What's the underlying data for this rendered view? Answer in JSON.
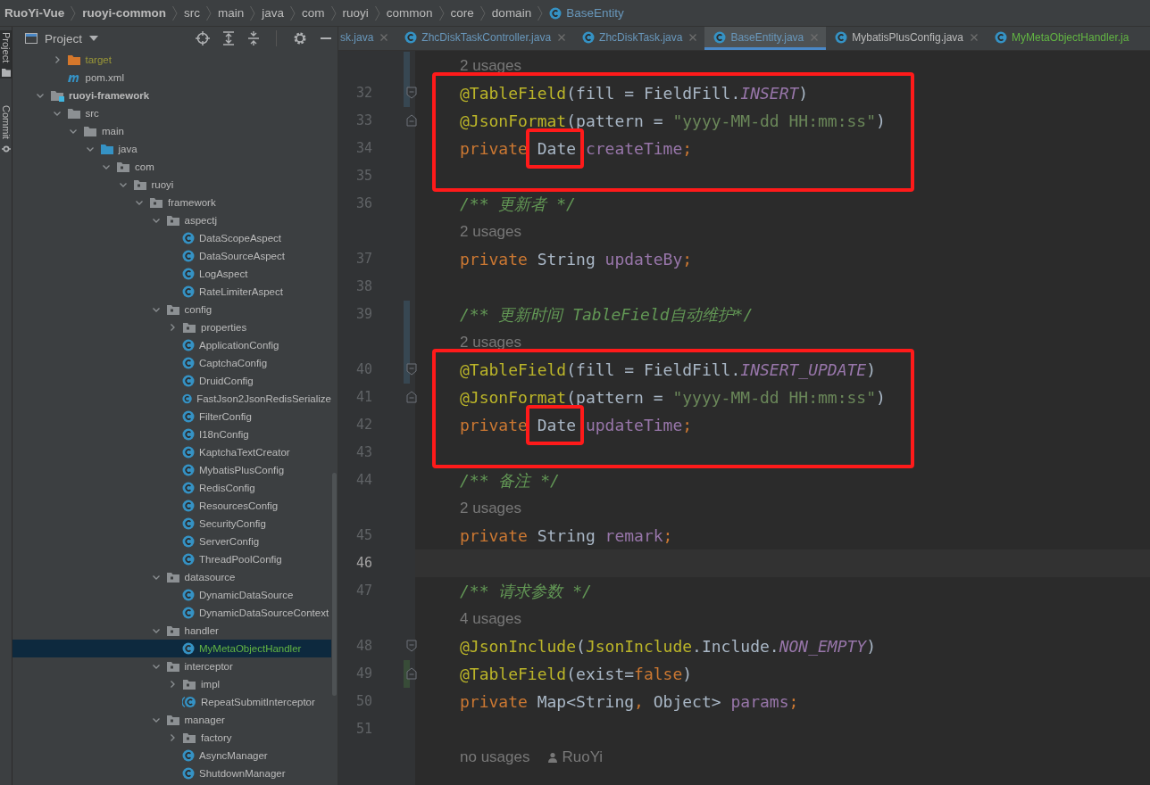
{
  "breadcrumbs": [
    {
      "label": "RuoYi-Vue",
      "kind": "module"
    },
    {
      "label": "ruoyi-common",
      "kind": "module"
    },
    {
      "label": "src",
      "kind": "folder"
    },
    {
      "label": "main",
      "kind": "folder"
    },
    {
      "label": "java",
      "kind": "folder"
    },
    {
      "label": "com",
      "kind": "folder"
    },
    {
      "label": "ruoyi",
      "kind": "folder"
    },
    {
      "label": "common",
      "kind": "folder"
    },
    {
      "label": "core",
      "kind": "folder"
    },
    {
      "label": "domain",
      "kind": "folder"
    },
    {
      "label": "BaseEntity",
      "kind": "class"
    }
  ],
  "side_strip": [
    {
      "label": "Project",
      "selected": true
    },
    {
      "label": "Commit",
      "selected": false
    }
  ],
  "panel": {
    "title": "Project"
  },
  "tree": [
    {
      "children": [
        {
          "label": "target",
          "kind": "excluded",
          "expanded": false,
          "selected": false,
          "color": "#9a9738"
        },
        {
          "label": "pom.xml",
          "kind": "maven",
          "selected": false,
          "color": "#bbbbbb"
        }
      ]
    },
    {
      "label": "ruoyi-framework",
      "kind": "module",
      "expanded": true,
      "selected": false,
      "color": "#bbbbbb",
      "children": [
        {
          "label": "src",
          "kind": "folder",
          "expanded": true,
          "selected": false,
          "color": "#bbbbbb",
          "children": [
            {
              "label": "main",
              "kind": "folder",
              "expanded": true,
              "selected": false,
              "color": "#bbbbbb",
              "children": [
                {
                  "label": "java",
                  "kind": "source",
                  "expanded": true,
                  "selected": false,
                  "color": "#bbbbbb",
                  "children": [
                    {
                      "label": "com",
                      "kind": "package",
                      "expanded": true,
                      "selected": false,
                      "color": "#bbbbbb",
                      "children": [
                        {
                          "label": "ruoyi",
                          "kind": "package",
                          "expanded": true,
                          "selected": false,
                          "color": "#bbbbbb",
                          "children": [
                            {
                              "label": "framework",
                              "kind": "package",
                              "expanded": true,
                              "selected": false,
                              "color": "#bbbbbb",
                              "children": [
                                {
                                  "label": "aspectj",
                                  "kind": "package",
                                  "expanded": true,
                                  "selected": false,
                                  "color": "#bbbbbb",
                                  "children": [
                                    {
                                      "label": "DataScopeAspect",
                                      "kind": "class",
                                      "selected": false,
                                      "color": "#bbbbbb"
                                    },
                                    {
                                      "label": "DataSourceAspect",
                                      "kind": "class",
                                      "selected": false,
                                      "color": "#bbbbbb"
                                    },
                                    {
                                      "label": "LogAspect",
                                      "kind": "class",
                                      "selected": false,
                                      "color": "#bbbbbb"
                                    },
                                    {
                                      "label": "RateLimiterAspect",
                                      "kind": "class",
                                      "selected": false,
                                      "color": "#bbbbbb"
                                    }
                                  ]
                                },
                                {
                                  "label": "config",
                                  "kind": "package",
                                  "expanded": true,
                                  "selected": false,
                                  "color": "#bbbbbb",
                                  "children": [
                                    {
                                      "label": "properties",
                                      "kind": "package",
                                      "expanded": false,
                                      "selected": false,
                                      "color": "#bbbbbb"
                                    },
                                    {
                                      "label": "ApplicationConfig",
                                      "kind": "class",
                                      "selected": false,
                                      "color": "#bbbbbb"
                                    },
                                    {
                                      "label": "CaptchaConfig",
                                      "kind": "class",
                                      "selected": false,
                                      "color": "#bbbbbb"
                                    },
                                    {
                                      "label": "DruidConfig",
                                      "kind": "class",
                                      "selected": false,
                                      "color": "#bbbbbb"
                                    },
                                    {
                                      "label": "FastJson2JsonRedisSerialize",
                                      "kind": "class",
                                      "selected": false,
                                      "color": "#bbbbbb"
                                    },
                                    {
                                      "label": "FilterConfig",
                                      "kind": "class",
                                      "selected": false,
                                      "color": "#bbbbbb"
                                    },
                                    {
                                      "label": "I18nConfig",
                                      "kind": "class",
                                      "selected": false,
                                      "color": "#bbbbbb"
                                    },
                                    {
                                      "label": "KaptchaTextCreator",
                                      "kind": "class",
                                      "selected": false,
                                      "color": "#bbbbbb"
                                    },
                                    {
                                      "label": "MybatisPlusConfig",
                                      "kind": "class",
                                      "selected": false,
                                      "color": "#bbbbbb"
                                    },
                                    {
                                      "label": "RedisConfig",
                                      "kind": "class",
                                      "selected": false,
                                      "color": "#bbbbbb"
                                    },
                                    {
                                      "label": "ResourcesConfig",
                                      "kind": "class",
                                      "selected": false,
                                      "color": "#bbbbbb"
                                    },
                                    {
                                      "label": "SecurityConfig",
                                      "kind": "class",
                                      "selected": false,
                                      "color": "#bbbbbb"
                                    },
                                    {
                                      "label": "ServerConfig",
                                      "kind": "class",
                                      "selected": false,
                                      "color": "#bbbbbb"
                                    },
                                    {
                                      "label": "ThreadPoolConfig",
                                      "kind": "class",
                                      "selected": false,
                                      "color": "#bbbbbb"
                                    }
                                  ]
                                },
                                {
                                  "label": "datasource",
                                  "kind": "package",
                                  "expanded": true,
                                  "selected": false,
                                  "color": "#bbbbbb",
                                  "children": [
                                    {
                                      "label": "DynamicDataSource",
                                      "kind": "class",
                                      "selected": false,
                                      "color": "#bbbbbb"
                                    },
                                    {
                                      "label": "DynamicDataSourceContext",
                                      "kind": "class",
                                      "selected": false,
                                      "color": "#bbbbbb"
                                    }
                                  ]
                                },
                                {
                                  "label": "handler",
                                  "kind": "package",
                                  "expanded": true,
                                  "selected": false,
                                  "color": "#bbbbbb",
                                  "children": [
                                    {
                                      "label": "MyMetaObjectHandler",
                                      "kind": "class",
                                      "selected": true,
                                      "color": "#62b543"
                                    }
                                  ]
                                },
                                {
                                  "label": "interceptor",
                                  "kind": "package",
                                  "expanded": true,
                                  "selected": false,
                                  "color": "#bbbbbb",
                                  "children": [
                                    {
                                      "label": "impl",
                                      "kind": "package",
                                      "expanded": false,
                                      "selected": false,
                                      "color": "#bbbbbb"
                                    },
                                    {
                                      "label": "RepeatSubmitInterceptor",
                                      "kind": "abstract",
                                      "selected": false,
                                      "color": "#bbbbbb"
                                    }
                                  ]
                                },
                                {
                                  "label": "manager",
                                  "kind": "package",
                                  "expanded": true,
                                  "selected": false,
                                  "color": "#bbbbbb",
                                  "children": [
                                    {
                                      "label": "factory",
                                      "kind": "package",
                                      "expanded": false,
                                      "selected": false,
                                      "color": "#bbbbbb"
                                    },
                                    {
                                      "label": "AsyncManager",
                                      "kind": "class",
                                      "selected": false,
                                      "color": "#bbbbbb"
                                    },
                                    {
                                      "label": "ShutdownManager",
                                      "kind": "class",
                                      "selected": false,
                                      "color": "#bbbbbb"
                                    }
                                  ]
                                }
                              ]
                            }
                          ]
                        }
                      ]
                    }
                  ]
                }
              ]
            }
          ]
        }
      ]
    }
  ],
  "tabs": [
    {
      "label": "sk.java",
      "kind": "partial",
      "selected": false,
      "color": "#6897bb"
    },
    {
      "label": "ZhcDiskTaskController.java",
      "kind": "class",
      "selected": false,
      "color": "#6897bb"
    },
    {
      "label": "ZhcDiskTask.java",
      "kind": "class",
      "selected": false,
      "color": "#6897bb"
    },
    {
      "label": "BaseEntity.java",
      "kind": "class",
      "selected": true,
      "color": "#6897bb"
    },
    {
      "label": "MybatisPlusConfig.java",
      "kind": "class",
      "selected": false,
      "color": "#bbbbbb"
    },
    {
      "label": "MyMetaObjectHandler.ja",
      "kind": "class",
      "selected": false,
      "color": "#62b543"
    }
  ],
  "editor": {
    "blocks": [
      {
        "boxed": false,
        "rows": [
          {
            "kind": "hint",
            "text": "2 usages",
            "color": "#374752"
          }
        ]
      },
      {
        "boxed": true,
        "rows": [
          {
            "kind": "code",
            "number": "32",
            "current": false,
            "fold_open": true,
            "color": "#374752",
            "tokens": [
              {
                "kind": "ann",
                "text": "@TableField"
              },
              {
                "kind": "plain",
                "text": "(fill = FieldFill."
              },
              {
                "kind": "const",
                "text": "INSERT"
              },
              {
                "kind": "plain",
                "text": ")"
              }
            ]
          },
          {
            "kind": "code",
            "number": "33",
            "current": false,
            "fold_close": true,
            "tokens": [
              {
                "kind": "ann",
                "text": "@JsonFormat"
              },
              {
                "kind": "plain",
                "text": "(pattern = "
              },
              {
                "kind": "str",
                "text": "\"yyyy-MM-dd HH:mm:ss\""
              },
              {
                "kind": "plain",
                "text": ")"
              }
            ]
          },
          {
            "kind": "code",
            "number": "34",
            "current": false,
            "tokens": [
              {
                "kind": "kw",
                "text": "private "
              },
              {
                "kind": "plain",
                "text": "Date",
                "boxed": true
              },
              {
                "kind": "field",
                "text": " createTime"
              },
              {
                "kind": "kw",
                "text": ";"
              }
            ]
          },
          {
            "kind": "code",
            "number": "35",
            "current": false,
            "tokens": []
          }
        ]
      },
      {
        "boxed": false,
        "rows": [
          {
            "kind": "code",
            "number": "36",
            "current": false,
            "tokens": [
              {
                "kind": "comment",
                "text": "/** 更新者 */"
              }
            ]
          },
          {
            "kind": "hint",
            "text": "2 usages"
          },
          {
            "kind": "code",
            "number": "37",
            "current": false,
            "tokens": [
              {
                "kind": "kw",
                "text": "private"
              },
              {
                "kind": "plain",
                "text": " String "
              },
              {
                "kind": "field",
                "text": "updateBy"
              },
              {
                "kind": "kw",
                "text": ";"
              }
            ]
          },
          {
            "kind": "code",
            "number": "38",
            "current": false,
            "tokens": []
          },
          {
            "kind": "code",
            "number": "39",
            "current": false,
            "color": "#374752",
            "tokens": [
              {
                "kind": "comment",
                "text": "/** 更新时间 TableField自动维护*/"
              }
            ]
          },
          {
            "kind": "hint",
            "text": "2 usages",
            "color": "#374752"
          }
        ]
      },
      {
        "boxed": true,
        "rows": [
          {
            "kind": "code",
            "number": "40",
            "current": false,
            "fold_open": true,
            "color": "#374752",
            "tokens": [
              {
                "kind": "ann",
                "text": "@TableField"
              },
              {
                "kind": "plain",
                "text": "(fill = FieldFill."
              },
              {
                "kind": "const",
                "text": "INSERT_UPDATE"
              },
              {
                "kind": "plain",
                "text": ")"
              }
            ]
          },
          {
            "kind": "code",
            "number": "41",
            "current": false,
            "fold_close": true,
            "tokens": [
              {
                "kind": "ann",
                "text": "@JsonFormat"
              },
              {
                "kind": "plain",
                "text": "(pattern = "
              },
              {
                "kind": "str",
                "text": "\"yyyy-MM-dd HH:mm:ss\""
              },
              {
                "kind": "plain",
                "text": ")"
              }
            ]
          },
          {
            "kind": "code",
            "number": "42",
            "current": false,
            "tokens": [
              {
                "kind": "kw",
                "text": "private "
              },
              {
                "kind": "plain",
                "text": "Date",
                "boxed": true
              },
              {
                "kind": "field",
                "text": " updateTime"
              },
              {
                "kind": "kw",
                "text": ";"
              }
            ]
          },
          {
            "kind": "code",
            "number": "43",
            "current": false,
            "tokens": []
          }
        ]
      },
      {
        "boxed": false,
        "rows": [
          {
            "kind": "code",
            "number": "44",
            "current": false,
            "tokens": [
              {
                "kind": "comment",
                "text": "/** 备注 */"
              }
            ]
          },
          {
            "kind": "hint",
            "text": "2 usages"
          },
          {
            "kind": "code",
            "number": "45",
            "current": false,
            "tokens": [
              {
                "kind": "kw",
                "text": "private"
              },
              {
                "kind": "plain",
                "text": " String "
              },
              {
                "kind": "field",
                "text": "remark"
              },
              {
                "kind": "kw",
                "text": ";"
              }
            ]
          },
          {
            "kind": "code",
            "number": "46",
            "current": true,
            "tokens": []
          },
          {
            "kind": "code",
            "number": "47",
            "current": false,
            "tokens": [
              {
                "kind": "comment",
                "text": "/** 请求参数 */"
              }
            ]
          },
          {
            "kind": "hint",
            "text": "4 usages"
          },
          {
            "kind": "code",
            "number": "48",
            "current": false,
            "fold_open": true,
            "tokens": [
              {
                "kind": "ann",
                "text": "@JsonInclude"
              },
              {
                "kind": "plain",
                "text": "("
              },
              {
                "kind": "ann",
                "text": "JsonInclude"
              },
              {
                "kind": "plain",
                "text": ".Include."
              },
              {
                "kind": "const",
                "text": "NON_EMPTY"
              },
              {
                "kind": "plain",
                "text": ")"
              }
            ]
          },
          {
            "kind": "code",
            "number": "49",
            "current": false,
            "fold_close": true,
            "color": "#384c38",
            "tokens": [
              {
                "kind": "ann",
                "text": "@TableField"
              },
              {
                "kind": "plain",
                "text": "(exist="
              },
              {
                "kind": "kw",
                "text": "false"
              },
              {
                "kind": "plain",
                "text": ")"
              }
            ]
          },
          {
            "kind": "code",
            "number": "50",
            "current": false,
            "tokens": [
              {
                "kind": "kw",
                "text": "private"
              },
              {
                "kind": "plain",
                "text": " Map<String"
              },
              {
                "kind": "kw",
                "text": ","
              },
              {
                "kind": "plain",
                "text": " Object> "
              },
              {
                "kind": "field",
                "text": "params"
              },
              {
                "kind": "kw",
                "text": ";"
              }
            ]
          },
          {
            "kind": "code",
            "number": "51",
            "current": false,
            "tokens": []
          },
          {
            "kind": "hint",
            "text": "no usages",
            "author": "RuoYi"
          }
        ]
      }
    ]
  }
}
